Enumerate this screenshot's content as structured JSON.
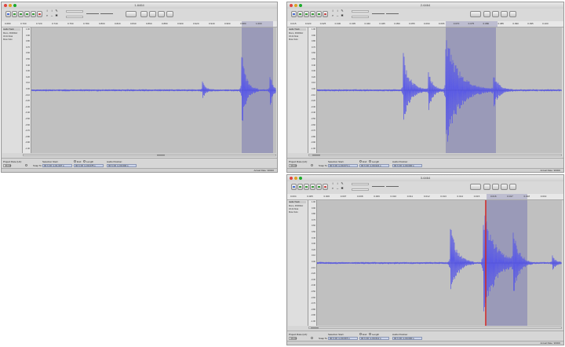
{
  "colors": {
    "waveform": "#5a5ae6",
    "selection": "#9a9ab8",
    "playhead": "#cc2b2b",
    "canvas": "#c0c0c0"
  },
  "windows": [
    {
      "id": "w1",
      "title": "1-6464",
      "rate": "Actual Rate: 96000",
      "ruler": [
        "0.680",
        "0.700",
        "0.720",
        "0.740",
        "0.760",
        "0.780",
        "0.800",
        "0.820",
        "0.840",
        "0.860",
        "0.880",
        "0.900",
        "0.920",
        "0.940",
        "0.960",
        "0.980",
        "1.000"
      ],
      "yticks": [
        "1.00",
        "0.90",
        "0.80",
        "0.70",
        "0.60",
        "0.50",
        "0.40",
        "0.30",
        "0.20",
        "0.10",
        "0.00",
        "-0.10",
        "-0.20",
        "-0.30",
        "-0.40",
        "-0.50",
        "-0.60",
        "-0.70",
        "-0.80",
        "-0.90",
        "-1.00"
      ],
      "track": {
        "name": "Audio Track",
        "info": [
          "Mono, 96000Hz",
          "32-bit float",
          "Mute  Solo"
        ]
      },
      "selbar": {
        "rate_label": "Project Rate (Hz):",
        "rate": "96000",
        "snap": "Snap To",
        "start_label": "Selection Start:",
        "end_label": "End",
        "length_label": "Length",
        "pos_label": "Audio Position:",
        "start": "00 h 00 m 01.007 s",
        "length": "00 h 00 m 00.078 s",
        "pos": "00 h 00 m 00.000 s"
      }
    },
    {
      "id": "w2",
      "title": "2-6464",
      "rate": "Actual Rate: 96000",
      "ruler": [
        "0.015",
        "0.020",
        "0.025",
        "0.030",
        "0.035",
        "0.040",
        "0.045",
        "0.050",
        "0.055",
        "0.060",
        "0.065",
        "0.070",
        "0.075",
        "0.080",
        "0.085",
        "0.090",
        "0.095",
        "0.100"
      ],
      "yticks": [
        "1.00",
        "0.90",
        "0.80",
        "0.70",
        "0.60",
        "0.50",
        "0.40",
        "0.30",
        "0.20",
        "0.10",
        "0.00",
        "-0.10",
        "-0.20",
        "-0.30",
        "-0.40",
        "-0.50",
        "-0.60",
        "-0.70",
        "-0.80",
        "-0.90",
        "-1.00"
      ],
      "track": {
        "name": "Audio Track",
        "info": [
          "Mono, 96000Hz",
          "32-bit float",
          "Mute  Solo"
        ]
      },
      "selbar": {
        "rate_label": "Project Rate (Hz):",
        "rate": "96000",
        "snap": "Snap To",
        "start_label": "Selection Start:",
        "end_label": "End",
        "length_label": "Length",
        "pos_label": "Audio Position:",
        "start": "00 h 00 m 00.071 s",
        "length": "00 h 00 m 00.021 s",
        "pos": "00 h 00 m 00.000 s"
      }
    },
    {
      "id": "w3",
      "title": "3-6464",
      "rate": "Actual Rate: 96000",
      "ruler": [
        "0.004",
        "0.005",
        "0.006",
        "0.007",
        "0.008",
        "0.009",
        "0.010",
        "0.011",
        "0.012",
        "0.013",
        "0.014",
        "0.015",
        "0.016",
        "0.017",
        "0.018",
        "0.019"
      ],
      "yticks": [
        "1.00",
        "0.90",
        "0.80",
        "0.70",
        "0.60",
        "0.50",
        "0.40",
        "0.30",
        "0.20",
        "0.10",
        "0.00",
        "-0.10",
        "-0.20",
        "-0.30",
        "-0.40",
        "-0.50",
        "-0.60",
        "-0.70",
        "-0.80",
        "-0.90",
        "-1.00"
      ],
      "track": {
        "name": "Audio Track",
        "info": [
          "Mono, 96000Hz",
          "32-bit float",
          "Mute  Solo"
        ]
      },
      "selbar": {
        "rate_label": "Project Rate (Hz):",
        "rate": "96000",
        "snap": "Snap To",
        "start_label": "Selection Start:",
        "end_label": "End",
        "length_label": "Length",
        "pos_label": "Audio Position:",
        "start": "00 h 00 m 00.015 s",
        "length": "00 h 00 m 00.012 s",
        "pos": "00 h 00 m 00.000 s"
      }
    }
  ],
  "toolbar": {
    "transport": [
      "pause-icon",
      "play-icon",
      "stop-icon",
      "skip-start-icon",
      "skip-end-icon",
      "record-icon"
    ],
    "tools": [
      "cursor-tool-icon",
      "envelope-tool-icon",
      "draw-tool-icon",
      "zoom-tool-icon",
      "timeshift-tool-icon",
      "multi-tool-icon"
    ],
    "device": "Built-in"
  }
}
